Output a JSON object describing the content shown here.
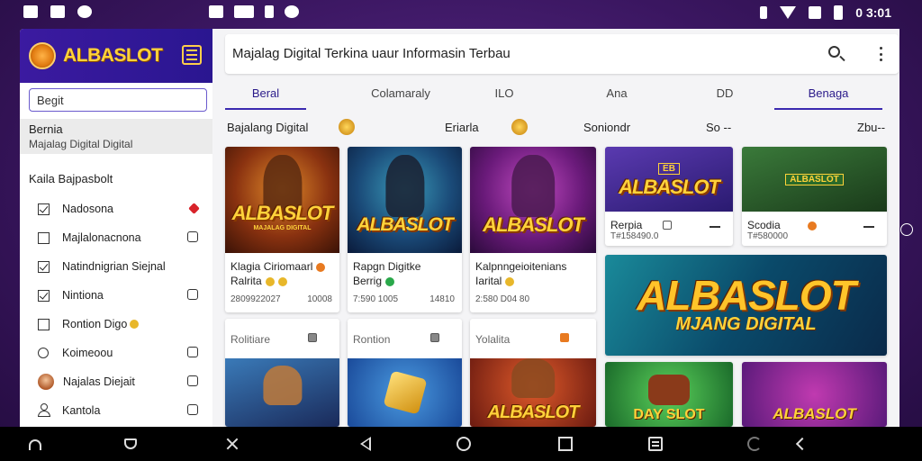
{
  "status_bar": {
    "clock": "0 3:01"
  },
  "sidebar": {
    "brand": "ALBASLOT",
    "search_value": "Begit",
    "active_item": {
      "title": "Bernia",
      "subtitle": "Majalag Digital Digital"
    },
    "section_title": "Kaila Bajpasbolt",
    "items": [
      {
        "label": "Nadosona"
      },
      {
        "label": "Majlalonacnona"
      },
      {
        "label": "Natindnigrian Siejnal"
      },
      {
        "label": "Nintiona"
      },
      {
        "label": "Rontion Digo"
      },
      {
        "label": "Koimeoou"
      },
      {
        "label": "Najalas Diejait"
      },
      {
        "label": "Kantola"
      }
    ]
  },
  "appbar": {
    "title": "Majalag Digital Terkina uaur Informasin Terbau"
  },
  "tabs": [
    {
      "label": "Beral",
      "active": true
    },
    {
      "label": "Colamaraly",
      "active": false
    },
    {
      "label": "ILO",
      "active": false
    },
    {
      "label": "Ana",
      "active": false
    },
    {
      "label": "DD",
      "active": false
    },
    {
      "label": "Benaga",
      "active": true
    }
  ],
  "filter_row": {
    "label1": "Bajalang Digital",
    "label2": "Eriarla",
    "label3": "Soniondr",
    "label4": "So --",
    "label5": "Zbu--"
  },
  "cards_row1": [
    {
      "logo": "ALBASLOT",
      "sublogo": "MAJALAG DIGITAL",
      "line1": "Klagia Ciriomaarl",
      "line2": "Ralrita",
      "meta": "2809922027",
      "meta_right": "10008"
    },
    {
      "logo": "ALBASLOT",
      "sublogo": "",
      "line1": "Rapgn Digitke",
      "line2": "Berrig",
      "meta": "7:590 1005",
      "meta_right": "14810"
    },
    {
      "logo": "ALBASLOT",
      "sublogo": "",
      "line1": "Kalpnngeioitenians",
      "line2": "Iarital",
      "meta": "2:580 D04 80",
      "meta_right": ""
    }
  ],
  "cards_small": [
    {
      "logo": "ALBASLOT",
      "badge": "EB",
      "line1": "Rerpia",
      "meta": "T#158490.0"
    },
    {
      "logo": "",
      "badge": "ALBASLOT",
      "line1": "Scodia",
      "meta": "T#580000"
    }
  ],
  "banner": {
    "logo": "ALBASLOT",
    "subtitle": "MJANG DIGITAL"
  },
  "cards_row2": [
    {
      "label": "Rolitiare",
      "logo": ""
    },
    {
      "label": "Rontion",
      "logo": ""
    },
    {
      "label": "Yolalita",
      "logo": "ALBASLOT"
    },
    {
      "label": "",
      "logo": "DAY SLOT"
    },
    {
      "label": "",
      "logo": "ALBASLOT"
    }
  ],
  "colors": {
    "brand": "#2a1690",
    "accent": "#3b2ab0",
    "logo_gold": "#ffd23a",
    "background": "#3a1660"
  }
}
